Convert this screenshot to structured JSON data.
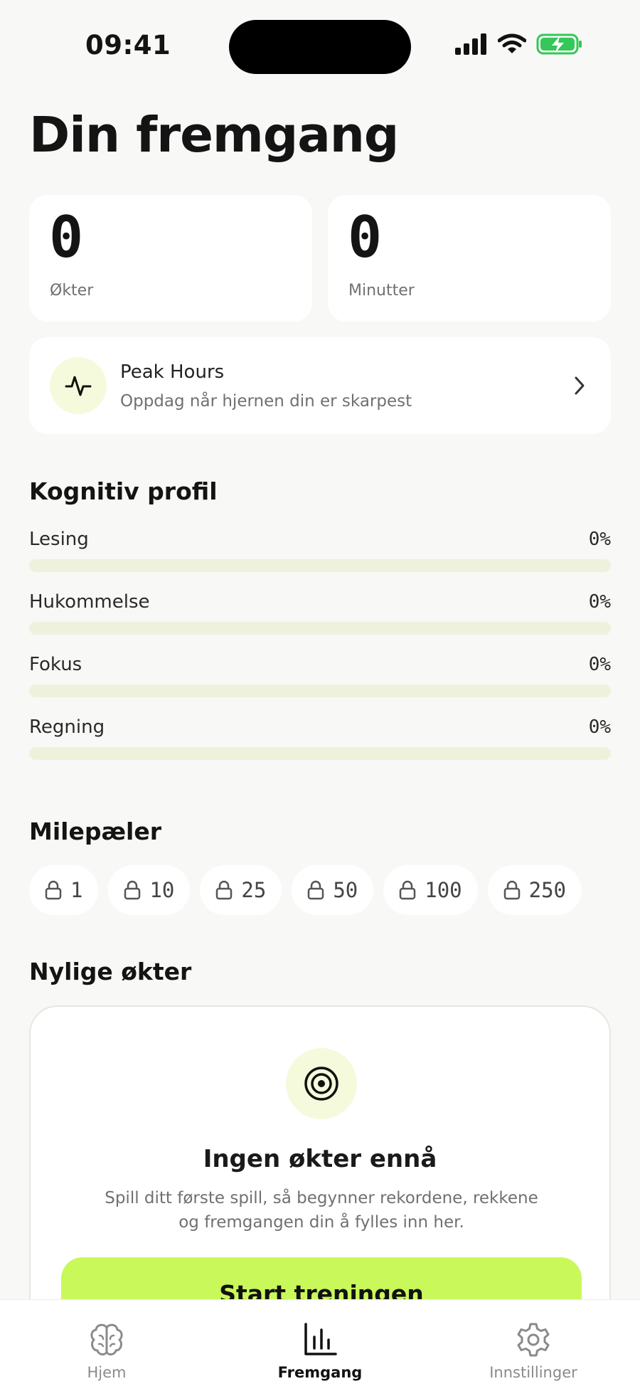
{
  "status_bar": {
    "time": "09:41"
  },
  "page": {
    "title": "Din fremgang"
  },
  "stats": [
    {
      "value": "0",
      "label": "Økter"
    },
    {
      "value": "0",
      "label": "Minutter"
    }
  ],
  "peak": {
    "title": "Peak Hours",
    "subtitle": "Oppdag når hjernen din er skarpest",
    "icon": "activity-icon"
  },
  "cognitive": {
    "title": "Kognitiv profil",
    "skills": [
      {
        "name": "Lesing",
        "percent_label": "0%",
        "percent": 0
      },
      {
        "name": "Hukommelse",
        "percent_label": "0%",
        "percent": 0
      },
      {
        "name": "Fokus",
        "percent_label": "0%",
        "percent": 0
      },
      {
        "name": "Regning",
        "percent_label": "0%",
        "percent": 0
      }
    ]
  },
  "milestones": {
    "title": "Milepæler",
    "items": [
      {
        "value": "1"
      },
      {
        "value": "10"
      },
      {
        "value": "25"
      },
      {
        "value": "50"
      },
      {
        "value": "100"
      },
      {
        "value": "250"
      }
    ],
    "icon": "lock-icon"
  },
  "recent": {
    "title": "Nylige økter",
    "empty_title": "Ingen økter ennå",
    "empty_text": "Spill ditt første spill, så begynner rekordene, rekkene og fremgangen din å fylles inn her.",
    "button": "Start treningen",
    "icon": "target-icon"
  },
  "tabbar": {
    "items": [
      {
        "label": "Hjem",
        "icon": "brain-icon",
        "active": false
      },
      {
        "label": "Fremgang",
        "icon": "bar-chart-icon",
        "active": true
      },
      {
        "label": "Innstillinger",
        "icon": "gear-icon",
        "active": false
      }
    ]
  },
  "colors": {
    "accent": "#c9f85a",
    "accent_soft": "#f5fadc",
    "background": "#f8f8f6",
    "battery": "#34c759"
  }
}
